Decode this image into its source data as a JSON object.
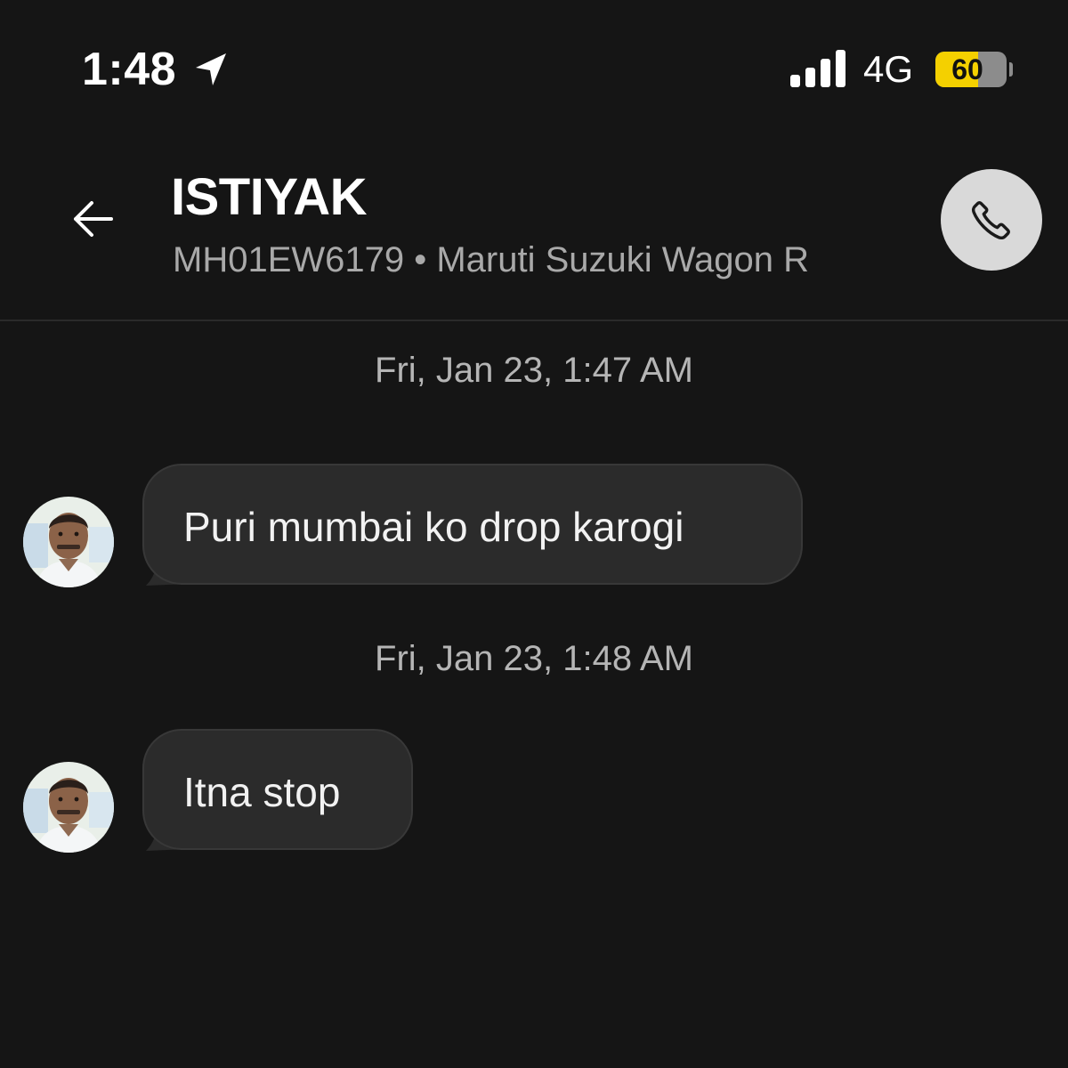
{
  "status_bar": {
    "time": "1:48",
    "location_icon": "location-arrow-icon",
    "signal_icon": "cellular-signal-icon",
    "network": "4G",
    "battery_percent": "60",
    "battery_level": 0.6,
    "battery_color": "#f4d000"
  },
  "header": {
    "back_icon": "back-arrow-icon",
    "name": "ISTIYAK",
    "subtitle": "MH01EW6179 • Maruti Suzuki Wagon R",
    "call_icon": "phone-icon"
  },
  "messages": [
    {
      "timestamp": "Fri, Jan 23, 1:47 AM",
      "text": "Puri mumbai ko drop karogi"
    },
    {
      "timestamp": "Fri, Jan 23, 1:48 AM",
      "text": "Itna stop"
    }
  ],
  "colors": {
    "background": "#151515",
    "bubble": "#2b2b2b",
    "call_button": "#d9d9d9"
  }
}
